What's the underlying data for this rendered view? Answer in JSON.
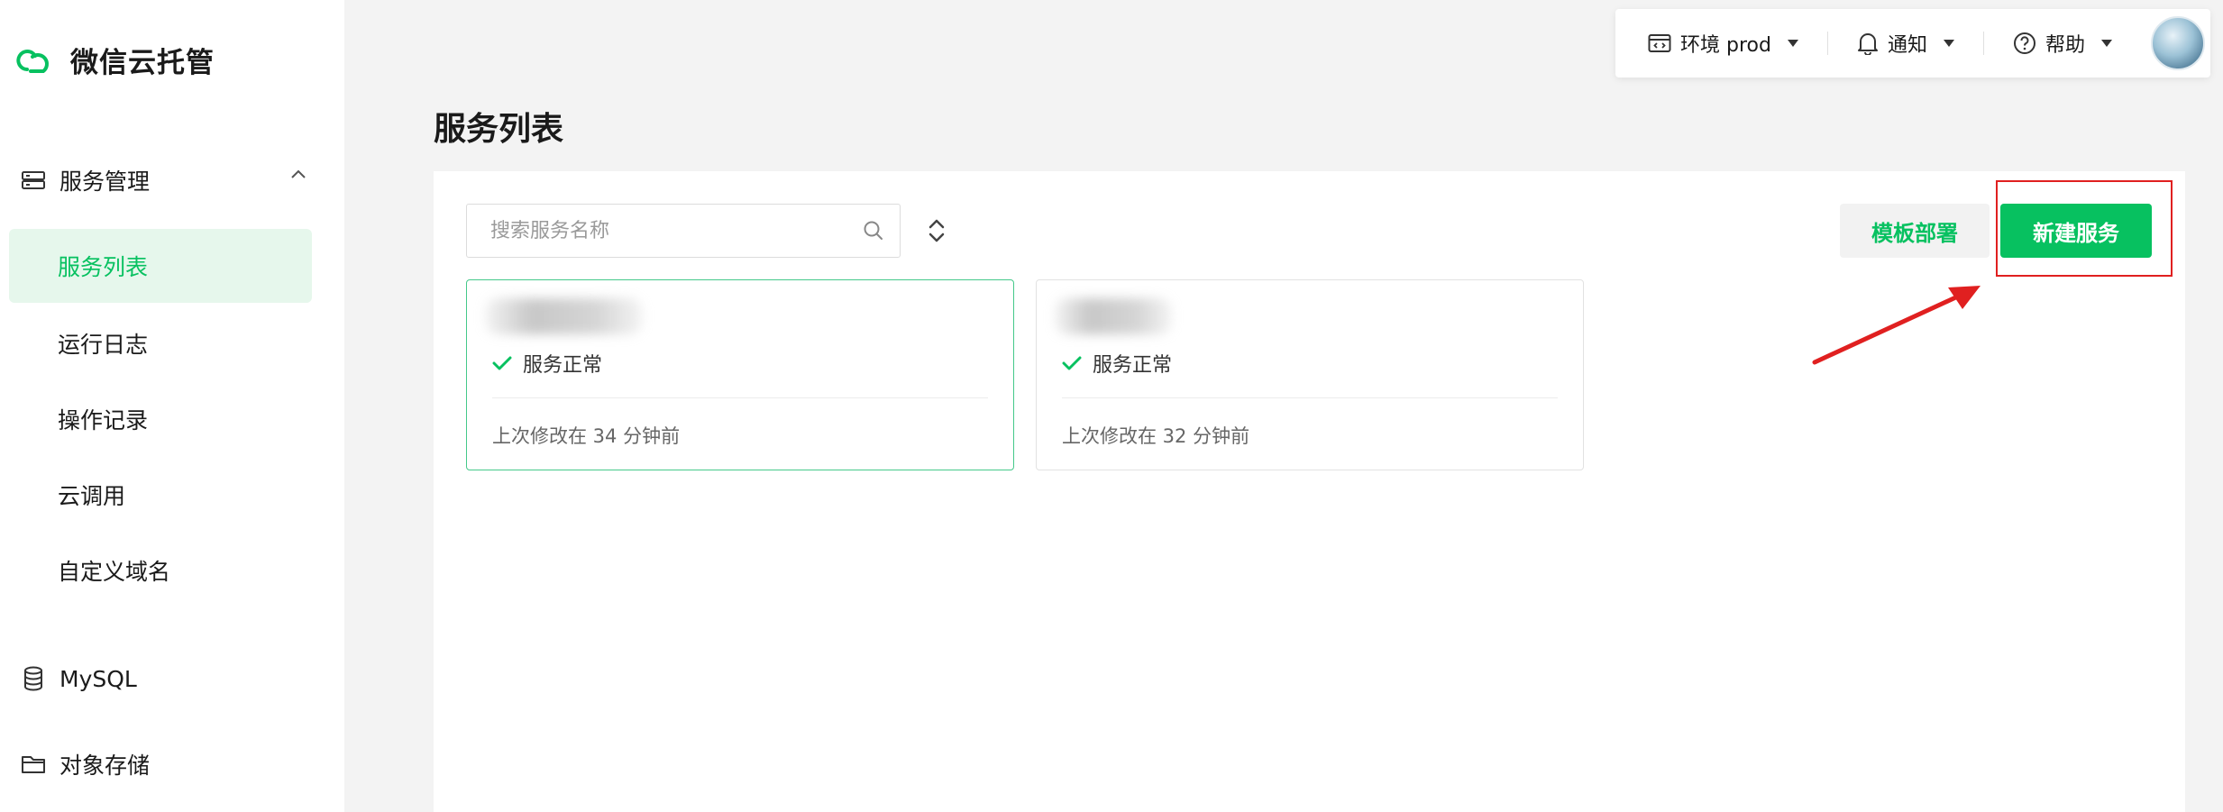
{
  "brand": {
    "name": "微信云托管",
    "accent": "#07c160"
  },
  "topbar": {
    "env_label": "环境 prod",
    "notify_label": "通知",
    "help_label": "帮助"
  },
  "sidebar": {
    "group_services": "服务管理",
    "items": [
      {
        "label": "服务列表",
        "active": true
      },
      {
        "label": "运行日志"
      },
      {
        "label": "操作记录"
      },
      {
        "label": "云调用"
      },
      {
        "label": "自定义域名"
      }
    ],
    "group_mysql": "MySQL",
    "group_storage": "对象存储"
  },
  "main": {
    "title": "服务列表",
    "search_placeholder": "搜索服务名称",
    "template_button": "模板部署",
    "new_button": "新建服务",
    "cards": [
      {
        "status": "服务正常",
        "modified": "上次修改在 34 分钟前"
      },
      {
        "status": "服务正常",
        "modified": "上次修改在 32 分钟前"
      }
    ]
  },
  "colors": {
    "accent": "#07c160",
    "annotation": "#e02020"
  }
}
